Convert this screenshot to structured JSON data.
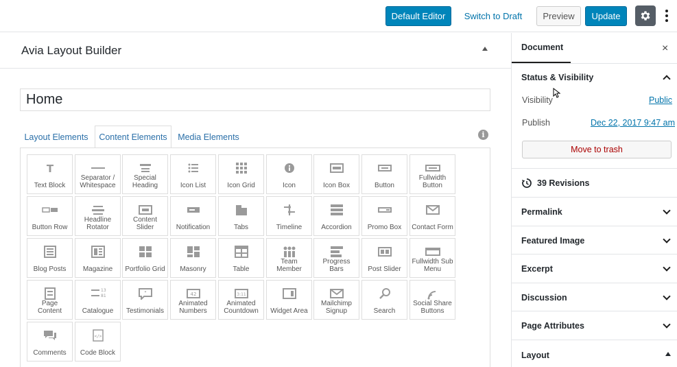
{
  "topbar": {
    "default_editor": "Default Editor",
    "switch_to_draft": "Switch to Draft",
    "preview": "Preview",
    "update": "Update"
  },
  "builder": {
    "title": "Avia Layout Builder",
    "post_title": "Home",
    "tabs": [
      "Layout Elements",
      "Content Elements",
      "Media Elements"
    ],
    "info": "i",
    "elements": [
      {
        "label": "Text Block",
        "icon": "text-block-icon"
      },
      {
        "label": "Separator / Whitespace",
        "icon": "separator-icon"
      },
      {
        "label": "Special Heading",
        "icon": "special-heading-icon"
      },
      {
        "label": "Icon List",
        "icon": "icon-list-icon"
      },
      {
        "label": "Icon Grid",
        "icon": "icon-grid-icon"
      },
      {
        "label": "Icon",
        "icon": "icon-icon"
      },
      {
        "label": "Icon Box",
        "icon": "icon-box-icon"
      },
      {
        "label": "Button",
        "icon": "button-icon"
      },
      {
        "label": "Fullwidth Button",
        "icon": "fullwidth-button-icon"
      },
      {
        "label": "Button Row",
        "icon": "button-row-icon"
      },
      {
        "label": "Headline Rotator",
        "icon": "headline-rotator-icon"
      },
      {
        "label": "Content Slider",
        "icon": "content-slider-icon"
      },
      {
        "label": "Notification",
        "icon": "notification-icon"
      },
      {
        "label": "Tabs",
        "icon": "tabs-icon"
      },
      {
        "label": "Timeline",
        "icon": "timeline-icon"
      },
      {
        "label": "Accordion",
        "icon": "accordion-icon"
      },
      {
        "label": "Promo Box",
        "icon": "promo-box-icon"
      },
      {
        "label": "Contact Form",
        "icon": "contact-form-icon"
      },
      {
        "label": "Blog Posts",
        "icon": "blog-posts-icon"
      },
      {
        "label": "Magazine",
        "icon": "magazine-icon"
      },
      {
        "label": "Portfolio Grid",
        "icon": "portfolio-grid-icon"
      },
      {
        "label": "Masonry",
        "icon": "masonry-icon"
      },
      {
        "label": "Table",
        "icon": "table-icon"
      },
      {
        "label": "Team Member",
        "icon": "team-member-icon"
      },
      {
        "label": "Progress Bars",
        "icon": "progress-bars-icon"
      },
      {
        "label": "Post Slider",
        "icon": "post-slider-icon"
      },
      {
        "label": "Fullwidth Sub Menu",
        "icon": "fullwidth-sub-menu-icon"
      },
      {
        "label": "Page Content",
        "icon": "page-content-icon"
      },
      {
        "label": "Catalogue",
        "icon": "catalogue-icon"
      },
      {
        "label": "Testimonials",
        "icon": "testimonials-icon"
      },
      {
        "label": "Animated Numbers",
        "icon": "animated-numbers-icon"
      },
      {
        "label": "Animated Countdown",
        "icon": "animated-countdown-icon"
      },
      {
        "label": "Widget Area",
        "icon": "widget-area-icon"
      },
      {
        "label": "Mailchimp Signup",
        "icon": "mailchimp-signup-icon"
      },
      {
        "label": "Search",
        "icon": "search-icon"
      },
      {
        "label": "Social Share Buttons",
        "icon": "social-share-icon"
      },
      {
        "label": "Comments",
        "icon": "comments-icon"
      },
      {
        "label": "Code Block",
        "icon": "code-block-icon"
      }
    ]
  },
  "sidebar": {
    "tab": "Document",
    "close": "×",
    "status_title": "Status & Visibility",
    "visibility_label": "Visibility",
    "visibility_value": "Public",
    "publish_label": "Publish",
    "publish_value": "Dec 22, 2017 9:47 am",
    "move_to_trash": "Move to trash",
    "revisions": "39 Revisions",
    "permalink": "Permalink",
    "featured_image": "Featured Image",
    "excerpt": "Excerpt",
    "discussion": "Discussion",
    "page_attributes": "Page Attributes",
    "layout": "Layout"
  }
}
